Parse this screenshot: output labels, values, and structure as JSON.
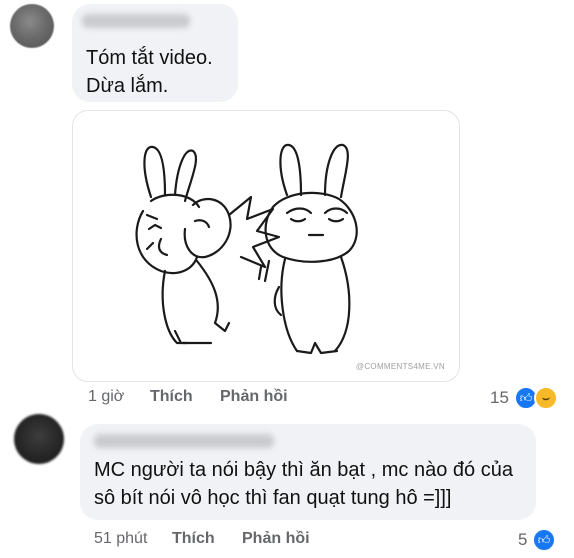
{
  "comments": [
    {
      "text_lines": [
        "Tóm tắt video.",
        "Dừa lắm."
      ],
      "watermark": "@COMMENTS4ME.VN",
      "time": "1 giờ",
      "like_label": "Thích",
      "reply_label": "Phản hồi",
      "reaction_count": "15",
      "reactions": [
        "like-icon",
        "haha-icon"
      ]
    },
    {
      "text_lines": [
        "MC người ta nói bậy thì ăn bạt , mc nào đó của",
        "sô bít nói vô học thì fan quạt tung hô =]]]"
      ],
      "time": "51 phút",
      "like_label": "Thích",
      "reply_label": "Phản hồi",
      "reaction_count": "5",
      "reactions": [
        "like-icon"
      ]
    }
  ],
  "colors": {
    "bubble": "#f0f2f5",
    "meta_text": "#65676b",
    "like_blue": "#1877f2",
    "haha_yellow": "#f7b928"
  }
}
